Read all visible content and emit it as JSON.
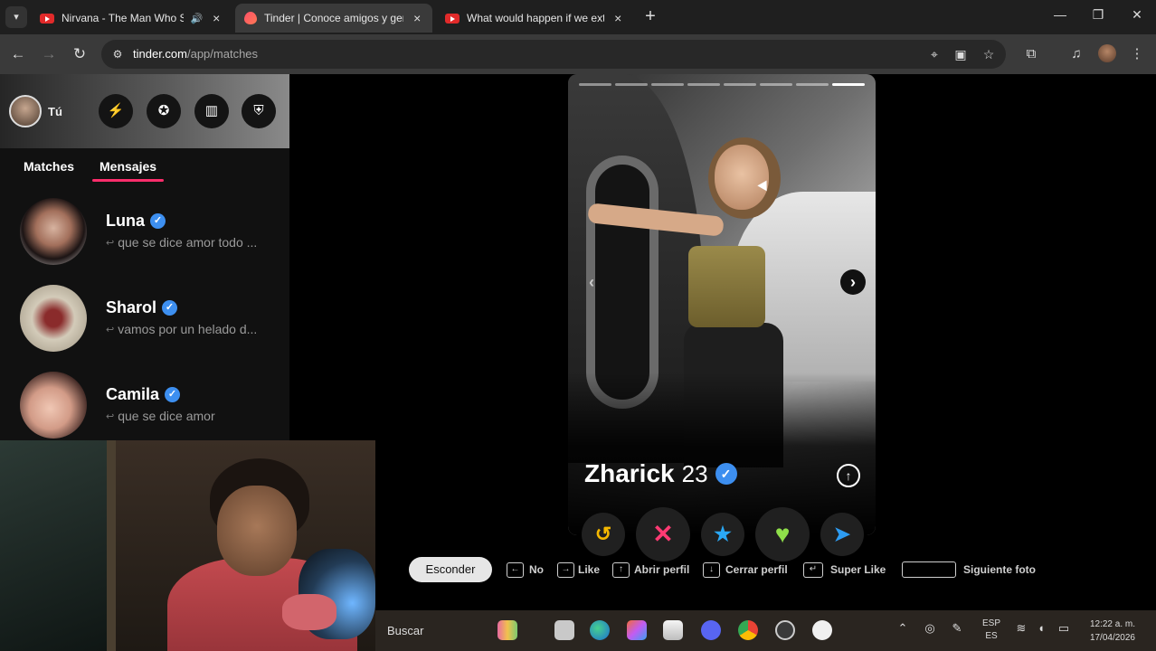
{
  "browser": {
    "tabs": [
      {
        "title": "Nirvana - The Man Who Sold",
        "active": false
      },
      {
        "title": "Tinder | Conoce amigos y gente",
        "active": true
      },
      {
        "title": "What would happen if we exter",
        "active": false
      }
    ],
    "url_host": "tinder.com",
    "url_path": "/app/matches"
  },
  "sidebar": {
    "user_label": "Tú",
    "tabs": [
      "Matches",
      "Mensajes"
    ],
    "active_tab": "Mensajes",
    "messages": [
      {
        "name": "Luna",
        "preview": "que se dice amor todo ..."
      },
      {
        "name": "Sharol",
        "preview": "vamos por un helado d..."
      },
      {
        "name": "Camila",
        "preview": "que se dice amor"
      }
    ]
  },
  "profile": {
    "name": "Zharick",
    "age": "23",
    "photo_count": 8,
    "current_photo": 8
  },
  "shortcuts": {
    "hide_label": "Esconder",
    "no": "No",
    "like": "Like",
    "open_profile": "Abrir perfil",
    "close_profile": "Cerrar perfil",
    "super_like": "Super Like",
    "next_photo": "Siguiente foto"
  },
  "taskbar": {
    "search_placeholder": "Buscar",
    "lang_top": "ESP",
    "lang_bottom": "ES",
    "time": "12:22 a. m.",
    "date": "17/04/2026"
  },
  "colors": {
    "accent": "#fd2d6b",
    "verify": "#3d8ff0",
    "rewind": "#f5b800",
    "nope": "#fd3a73",
    "superlike": "#2aa8f5",
    "like": "#8fe04a",
    "boost": "#2d9cf2"
  }
}
